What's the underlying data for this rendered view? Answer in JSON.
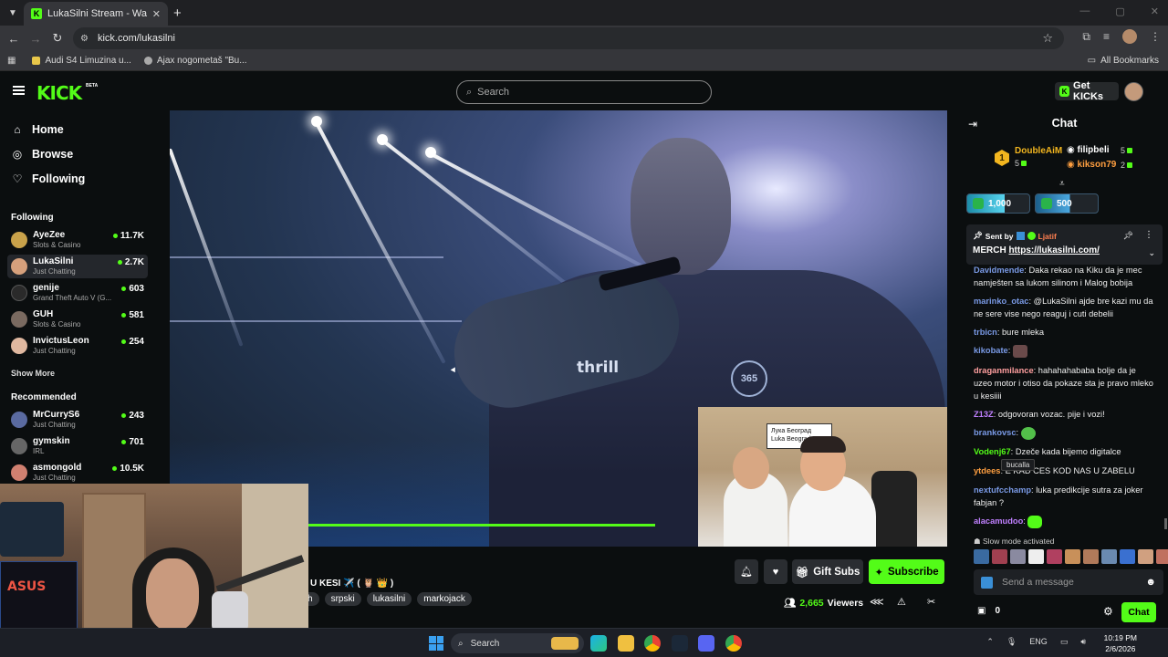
{
  "browser": {
    "tab_title": "LukaSilni Stream - Watch Live o",
    "url": "kick.com/lukasilni",
    "bookmarks": [
      {
        "label": "Audi S4 Limuzina u..."
      },
      {
        "label": "Ajax nogometaš \"Bu..."
      }
    ],
    "all_bookmarks": "All Bookmarks"
  },
  "header": {
    "logo": "KICK",
    "beta": "BETA",
    "search_placeholder": "Search",
    "get_kicks": "Get KICKs"
  },
  "sidebar": {
    "nav": [
      {
        "label": "Home",
        "icon": "home-icon"
      },
      {
        "label": "Browse",
        "icon": "compass-icon"
      },
      {
        "label": "Following",
        "icon": "heart-icon"
      }
    ],
    "following_title": "Following",
    "following": [
      {
        "name": "AyeZee",
        "category": "Slots & Casino",
        "viewers": "11.7K",
        "color": "#c9a24a"
      },
      {
        "name": "LukaSilni",
        "category": "Just Chatting",
        "viewers": "2.7K",
        "color": "#d6a07c"
      },
      {
        "name": "genije",
        "category": "Grand Theft Auto V (G...",
        "viewers": "603",
        "color": "#2a2a2a"
      },
      {
        "name": "GUH",
        "category": "Slots & Casino",
        "viewers": "581",
        "color": "#7a6a60"
      },
      {
        "name": "InvictusLeon",
        "category": "Just Chatting",
        "viewers": "254",
        "color": "#e0b8a0"
      }
    ],
    "show_more": "Show More",
    "recommended_title": "Recommended",
    "recommended": [
      {
        "name": "MrCurryS6",
        "category": "Just Chatting",
        "viewers": "243",
        "color": "#5a6aa0"
      },
      {
        "name": "gymskin",
        "category": "IRL",
        "viewers": "701",
        "color": "#666"
      },
      {
        "name": "asmongold",
        "category": "Just Chatting",
        "viewers": "10.5K",
        "color": "#d08070"
      }
    ]
  },
  "video": {
    "shirt_text": "thrill",
    "badge": "365",
    "sign_line1": "Лука Београд",
    "sign_line2": "Luka Beograd"
  },
  "stream": {
    "title": "U KESI ✈️ ( 🦉 👑 )",
    "tags": [
      "h",
      "srpski",
      "lukasilni",
      "markojack"
    ],
    "gift_subs": "Gift Subs",
    "subscribe": "Subscribe",
    "viewers": "2,665",
    "viewers_label": "Viewers"
  },
  "chat": {
    "title": "Chat",
    "leaderboard": [
      {
        "rank": "1",
        "name": "DoubleAiM",
        "count": "5",
        "color": "#f3b61f"
      },
      {
        "name": "filipbeli",
        "count": "5",
        "color": "#ffffff"
      },
      {
        "name": "kikson79",
        "count": "2",
        "color": "#ff9f40"
      }
    ],
    "kicks_counters": [
      "1,000",
      "500"
    ],
    "pinned": {
      "sent_by": "Sent by",
      "sender": "Ljatif",
      "message_prefix": "MERCH",
      "link": "https://lukasilni.com/"
    },
    "messages": [
      {
        "user": "Davidmende",
        "color": "#7a9ae6",
        "text": "Daka rekao na Kiku da je mec namješten sa lukom silinom i Malog bobija"
      },
      {
        "user": "marinko_otac",
        "color": "#7a9ae6",
        "text": "@LukaSilni ajde bre kazi mu da ne sere vise nego reaguj i cuti debelii"
      },
      {
        "user": "trbicn",
        "color": "#7a9ae6",
        "text": "bure mleka"
      },
      {
        "user": "kikobate",
        "color": "#7a9ae6",
        "text": ""
      },
      {
        "user": "draganmilance",
        "color": "#ff9f9f",
        "text": "hahahahababa bolje da je uzeo motor i otiso da pokaze sta je pravo mleko u kesiiii"
      },
      {
        "user": "Z13Z",
        "color": "#c080ff",
        "text": "odgovoran vozac. pije i vozi!"
      },
      {
        "user": "brankovsc",
        "color": "#7a9ae6",
        "text": ""
      },
      {
        "user": "Vodenj67",
        "color": "#53fc18",
        "text": "Dzeče kada bijemo digitalce"
      },
      {
        "user": "ytdees",
        "color": "#ff9f40",
        "text": "E KAD CES KOD NAS U ZABELU"
      },
      {
        "user": "nextufcchamp",
        "color": "#7a9ae6",
        "text": "luka predikcije sutra za joker fabjan ?"
      },
      {
        "user": "alacamudoo",
        "color": "#c080ff",
        "text": ""
      }
    ],
    "tooltip": "bucalla",
    "slow_mode": "Slow mode activated",
    "input_placeholder": "Send a message",
    "points": "0",
    "chat_button": "Chat"
  },
  "taskbar": {
    "search": "Search",
    "lang": "ENG",
    "time": "10:19 PM",
    "date": "2/6/2026"
  }
}
